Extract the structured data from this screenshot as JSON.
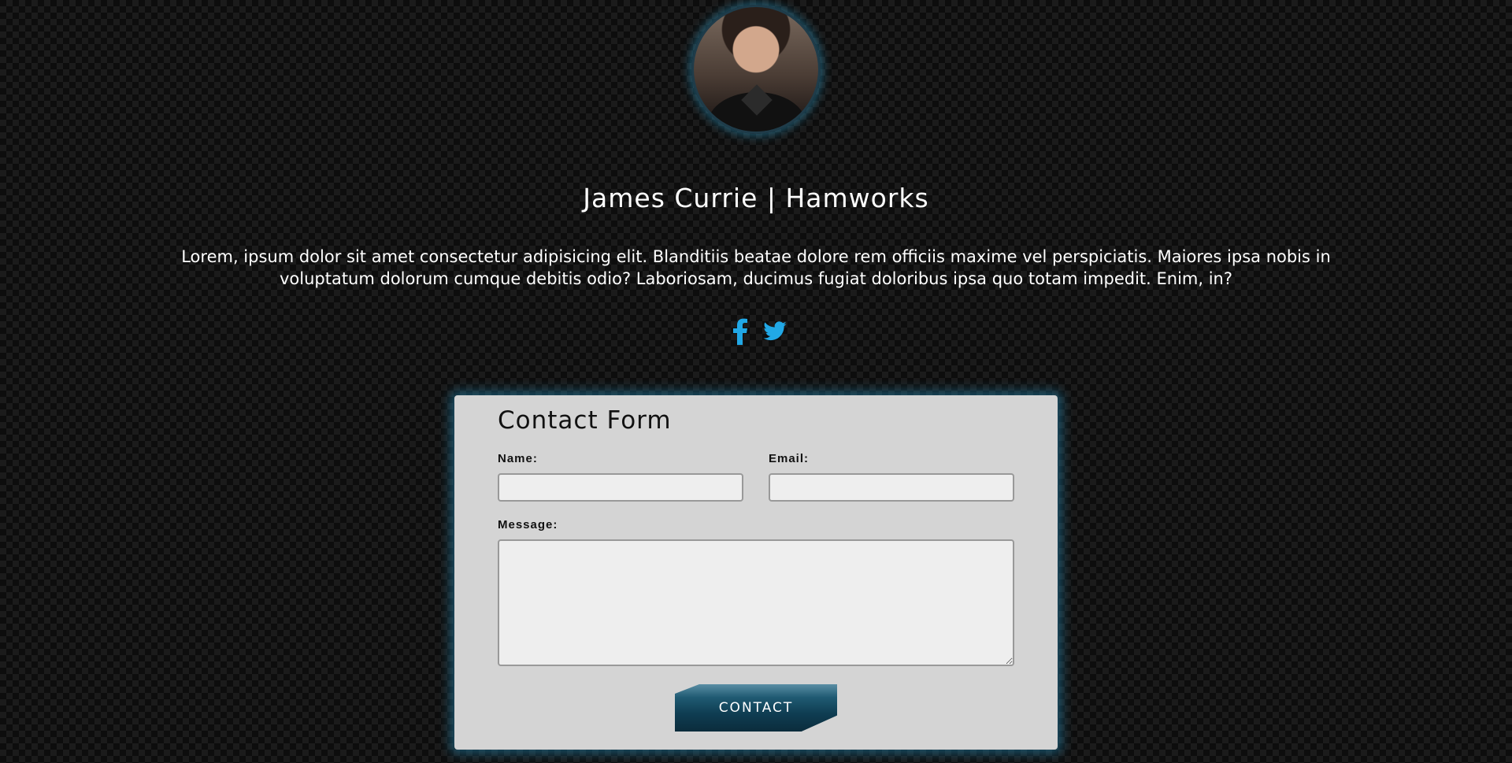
{
  "profile": {
    "title": "James Currie | Hamworks",
    "description": "Lorem, ipsum dolor sit amet consectetur adipisicing elit. Blanditiis beatae dolore rem officiis maxime vel perspiciatis. Maiores ipsa nobis in voluptatum dolorum cumque debitis odio? Laboriosam, ducimus fugiat doloribus ipsa quo totam impedit. Enim, in?"
  },
  "social": {
    "items": [
      {
        "icon": "facebook-icon"
      },
      {
        "icon": "twitter-icon"
      }
    ],
    "color": "#21a8e6"
  },
  "contact_form": {
    "heading": "Contact Form",
    "name_label": "Name:",
    "name_value": "",
    "email_label": "Email:",
    "email_value": "",
    "message_label": "Message:",
    "message_value": "",
    "submit_label": "CONTACT"
  },
  "colors": {
    "background": "#0d0d0d",
    "card": "#d4d4d4",
    "glow": "#2382aa",
    "accent": "#21a8e6"
  }
}
